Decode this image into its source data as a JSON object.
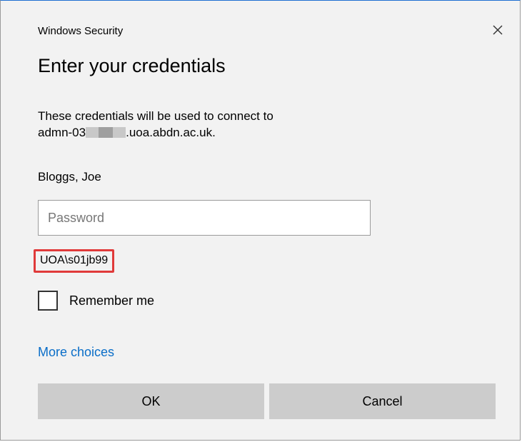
{
  "window": {
    "title": "Windows Security"
  },
  "dialog": {
    "heading": "Enter your credentials",
    "description_line1": "These credentials will be used to connect to",
    "host_prefix": "admn-03",
    "host_suffix": ".uoa.abdn.ac.uk.",
    "username": "Bloggs, Joe",
    "password_placeholder": "Password",
    "password_value": "",
    "domain_user": "UOA\\s01jb99",
    "remember_label": "Remember me",
    "remember_checked": false,
    "more_choices_label": "More choices",
    "ok_label": "OK",
    "cancel_label": "Cancel"
  },
  "icons": {
    "close": "close-icon"
  },
  "colors": {
    "background": "#f2f2f2",
    "link": "#0a6ec8",
    "highlight_border": "#e03a3a",
    "button": "#cccccc"
  }
}
